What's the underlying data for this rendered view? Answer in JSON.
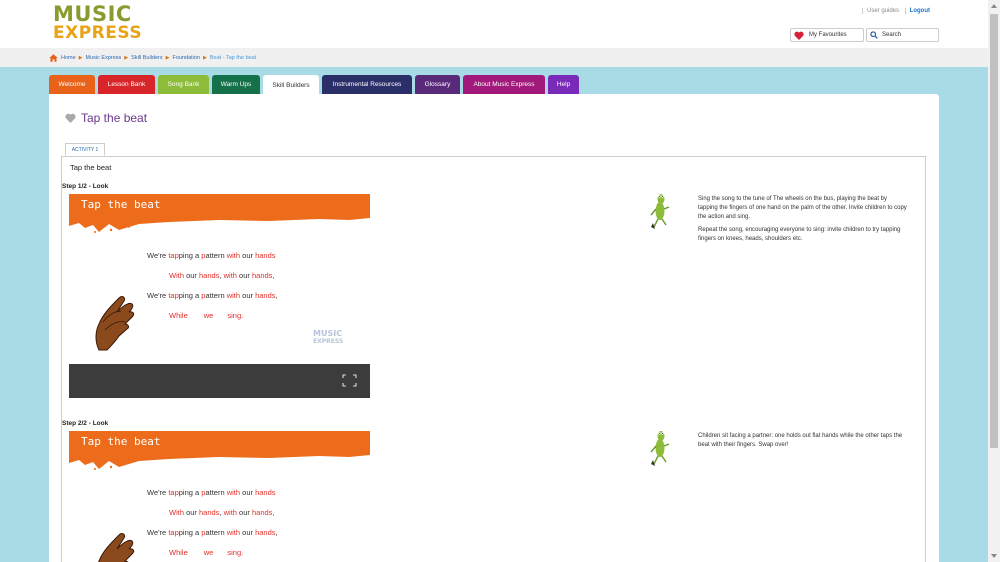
{
  "logo": {
    "line1": "MUSIC",
    "line2": "EXPRESS"
  },
  "header": {
    "user_guides": "User guides",
    "logout": "Logout",
    "favourites": "My Favourites",
    "search_placeholder": "Search"
  },
  "breadcrumb": [
    "Home",
    "Music Express",
    "Skill Builders",
    "Foundation",
    "Beat - Tap the beat"
  ],
  "tabs": [
    {
      "label": "Welcome",
      "color": "#e8621a"
    },
    {
      "label": "Lesson Bank",
      "color": "#d8252a"
    },
    {
      "label": "Song Bank",
      "color": "#8cbc3a"
    },
    {
      "label": "Warm Ups",
      "color": "#14714a"
    },
    {
      "label": "Skill Builders",
      "color": "#ffffff",
      "active": true
    },
    {
      "label": "Instrumental Resources",
      "color": "#2a2f6a"
    },
    {
      "label": "Glossary",
      "color": "#5a2a7a"
    },
    {
      "label": "About Music Express",
      "color": "#a1197a"
    },
    {
      "label": "Help",
      "color": "#7a2ab8"
    }
  ],
  "page": {
    "title": "Tap the beat",
    "activity_tab": "ACTIVITY 1",
    "panel_title": "Tap the beat"
  },
  "steps": [
    {
      "title": "Step 1/2 - Look",
      "banner": "Tap the beat",
      "notes": [
        "Sing the song to the tune of The wheels on the bus, playing the beat by tapping the fingers of one hand on the palm of the other. Invite children to copy the action and sing.",
        "Repeat the song, encouraging everyone to sing: invite children to try tapping fingers on knees, heads, shoulders etc."
      ]
    },
    {
      "title": "Step 2/2 - Look",
      "banner": "Tap the beat",
      "notes": [
        "Children sit facing a partner: one holds out flat hands while the other taps the beat with their fingers. Swap over!"
      ]
    }
  ],
  "lyrics": {
    "l1": [
      "We're ",
      "tap",
      "ping a ",
      "p",
      "attern ",
      "with",
      " our ",
      "hands"
    ],
    "l2": [
      "With",
      "  our  ",
      "hands",
      ",  ",
      "with",
      "  our  ",
      "hands",
      ","
    ],
    "l3": [
      "We're ",
      "tap",
      "ping a ",
      "p",
      "attern ",
      "with",
      " our ",
      "hands",
      ","
    ],
    "l4": [
      "While",
      "we",
      "sing."
    ]
  },
  "watermark": {
    "l1": "MUSIC",
    "l2": "EXPRESS"
  }
}
